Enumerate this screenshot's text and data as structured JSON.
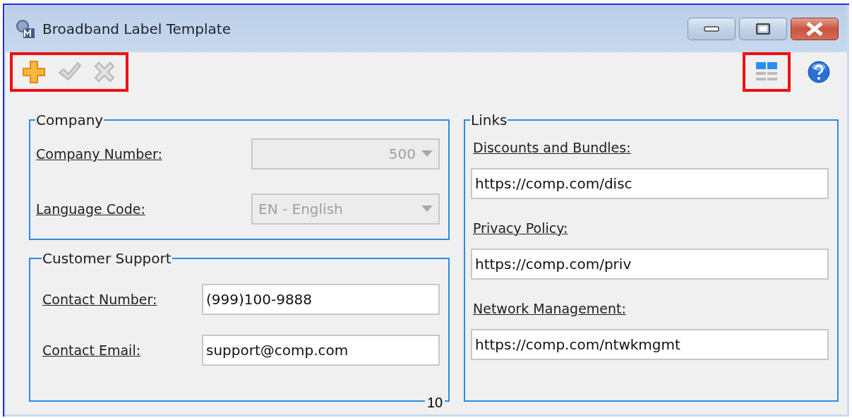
{
  "window": {
    "title": "Broadband Label Template",
    "controls": [
      {
        "kind": "minimize"
      },
      {
        "kind": "maximize"
      },
      {
        "kind": "close"
      }
    ]
  },
  "toolbar": {
    "left": {
      "highlighted": true,
      "buttons": [
        {
          "kind": "add",
          "disabled": false
        },
        {
          "kind": "save",
          "disabled": true
        },
        {
          "kind": "cancel",
          "disabled": true
        }
      ]
    },
    "right": [
      {
        "kind": "layout",
        "highlighted": true
      },
      {
        "kind": "help",
        "highlighted": false
      }
    ]
  },
  "company": {
    "title": "Company",
    "fields": [
      {
        "label": "Company Number:",
        "value": "500",
        "kind": "number_dropdown",
        "disabled": true
      },
      {
        "label": "Language Code:",
        "value": "EN - English",
        "kind": "dropdown",
        "disabled": true
      }
    ]
  },
  "customer_support": {
    "title": "Customer Support",
    "fields": [
      {
        "label": "Contact Number:",
        "value": "(999)100-9888",
        "kind": "text",
        "disabled": false
      },
      {
        "label": "Contact Email:",
        "value": "support@comp.com",
        "kind": "text",
        "disabled": false
      }
    ]
  },
  "links": {
    "title": "Links",
    "fields": [
      {
        "label": "Discounts and Bundles:",
        "value": "https://comp.com/disc"
      },
      {
        "label": "Privacy Policy:",
        "value": "https://comp.com/priv"
      },
      {
        "label": "Network Management:",
        "value": "https://comp.com/ntwkmgmt"
      }
    ]
  },
  "page_number": "10"
}
